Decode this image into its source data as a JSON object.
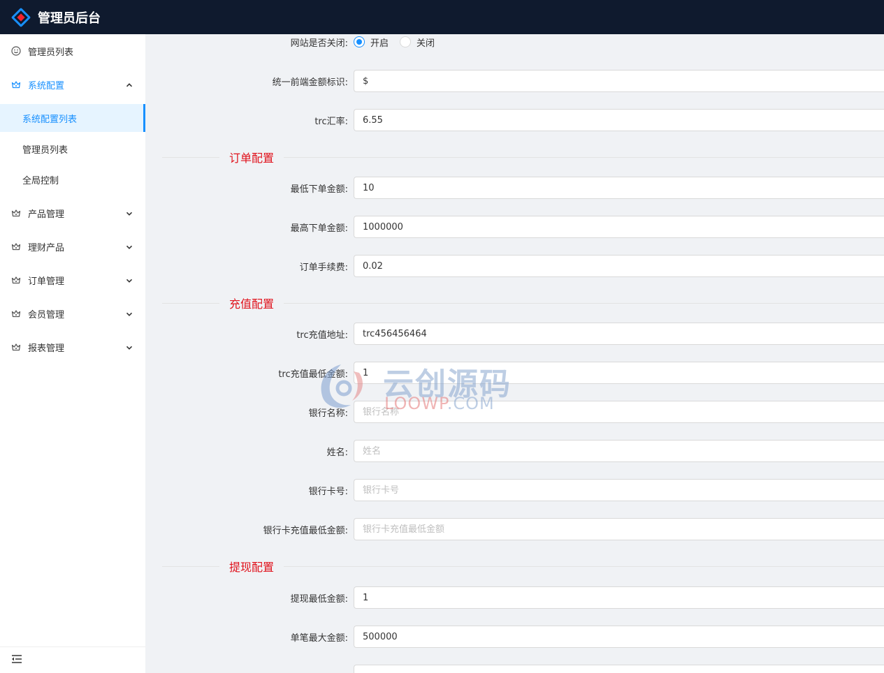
{
  "header": {
    "title": "管理员后台"
  },
  "sidebar": {
    "items": [
      {
        "label": "管理员列表",
        "icon": "smile-icon"
      },
      {
        "label": "系统配置",
        "icon": "crown-icon",
        "expanded": true,
        "children": [
          {
            "label": "系统配置列表",
            "selected": true
          },
          {
            "label": "管理员列表"
          },
          {
            "label": "全局控制"
          }
        ]
      },
      {
        "label": "产品管理",
        "icon": "crown-icon"
      },
      {
        "label": "理财产品",
        "icon": "crown-icon"
      },
      {
        "label": "订单管理",
        "icon": "crown-icon"
      },
      {
        "label": "会员管理",
        "icon": "crown-icon"
      },
      {
        "label": "报表管理",
        "icon": "crown-icon"
      }
    ],
    "footer_icon": "menu-fold-icon"
  },
  "form": {
    "site_close": {
      "label": "网站是否关闭:",
      "options": [
        "开启",
        "关闭"
      ],
      "selected": "开启"
    },
    "currency_symbol": {
      "label": "统一前端金额标识:",
      "value": "$"
    },
    "trc_rate": {
      "label": "trc汇率:",
      "value": "6.55"
    },
    "section_order": "订单配置",
    "min_order": {
      "label": "最低下单金额:",
      "value": "10"
    },
    "max_order": {
      "label": "最高下单金额:",
      "value": "1000000"
    },
    "order_fee": {
      "label": "订单手续费:",
      "value": "0.02"
    },
    "section_recharge": "充值配置",
    "trc_address": {
      "label": "trc充值地址:",
      "value": "trc456456464"
    },
    "trc_min": {
      "label": "trc充值最低金额:",
      "value": "1"
    },
    "bank_name": {
      "label": "银行名称:",
      "value": "",
      "placeholder": "银行名称"
    },
    "holder_name": {
      "label": "姓名:",
      "value": "",
      "placeholder": "姓名"
    },
    "bank_card": {
      "label": "银行卡号:",
      "value": "",
      "placeholder": "银行卡号"
    },
    "bank_min": {
      "label": "银行卡充值最低金额:",
      "value": "",
      "placeholder": "银行卡充值最低金额"
    },
    "section_withdraw": "提现配置",
    "withdraw_min": {
      "label": "提现最低金额:",
      "value": "1"
    },
    "withdraw_max": {
      "label": "单笔最大金额:",
      "value": "500000"
    }
  },
  "watermark": {
    "cn": "云创源码",
    "en_red": "LOOWP",
    "en_blue": ".COM"
  },
  "colors": {
    "accent": "#1890ff",
    "header_bg": "#0f1a2e",
    "section_title": "#e0111b"
  }
}
